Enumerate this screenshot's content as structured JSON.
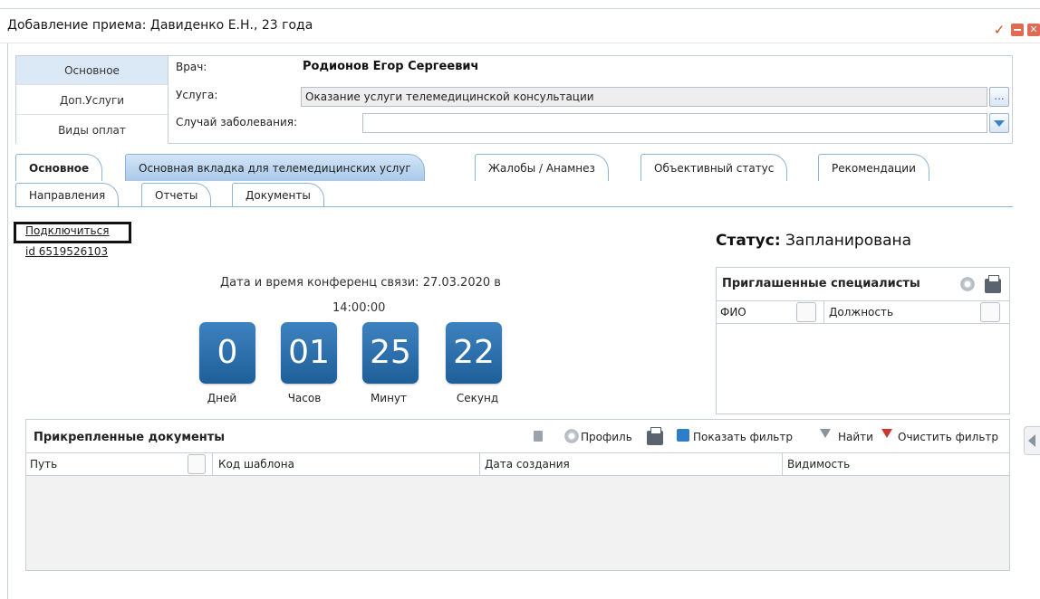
{
  "window": {
    "title": "Добавление приема: Давиденко Е.Н., 23 года",
    "accent": "#2d6fae"
  },
  "sidenav": {
    "items": [
      {
        "label": "Основное",
        "active": true
      },
      {
        "label": "Доп.Услуги",
        "active": false
      },
      {
        "label": "Виды оплат",
        "active": false
      }
    ]
  },
  "form": {
    "doctor_label": "Врач:",
    "doctor_value": "Родионов Егор Сергеевич",
    "service_label": "Услуга:",
    "service_value": "Оказание услуги телемедицинской консультации",
    "service_button": "...",
    "case_label": "Случай заболевания:",
    "case_value": ""
  },
  "tabs": {
    "row1": [
      {
        "label": "Основное",
        "selected": true
      },
      {
        "label": "Основная вкладка для телемедицинских услуг",
        "highlight": true
      },
      {
        "label": "Жалобы / Анамнез"
      },
      {
        "label": "Объективный статус"
      },
      {
        "label": "Рекомендации"
      }
    ],
    "row2": [
      {
        "label": "Направления"
      },
      {
        "label": "Отчеты"
      },
      {
        "label": "Документы"
      }
    ]
  },
  "main": {
    "connect_link": "Подключиться",
    "id_link": "id 6519526103",
    "status_label": "Статус:",
    "status_value": "Запланирована",
    "conference_text": "Дата и время конференц связи: 27.03.2020 в",
    "conference_time": "14:00:00",
    "countdown": [
      {
        "value": "0",
        "label": "Дней"
      },
      {
        "value": "01",
        "label": "Часов"
      },
      {
        "value": "25",
        "label": "Минут"
      },
      {
        "value": "22",
        "label": "Секунд"
      }
    ]
  },
  "invited": {
    "title": "Приглашенные специалисты",
    "columns": [
      "ФИО",
      "Должность"
    ]
  },
  "docs": {
    "title": "Прикрепленные документы",
    "toolbar": {
      "profile": "Профиль",
      "show_filter": "Показать фильтр",
      "find": "Найти",
      "clear_filter": "Очистить фильтр"
    },
    "columns": [
      "Путь",
      "Код шаблона",
      "Дата создания",
      "Видимость"
    ]
  }
}
